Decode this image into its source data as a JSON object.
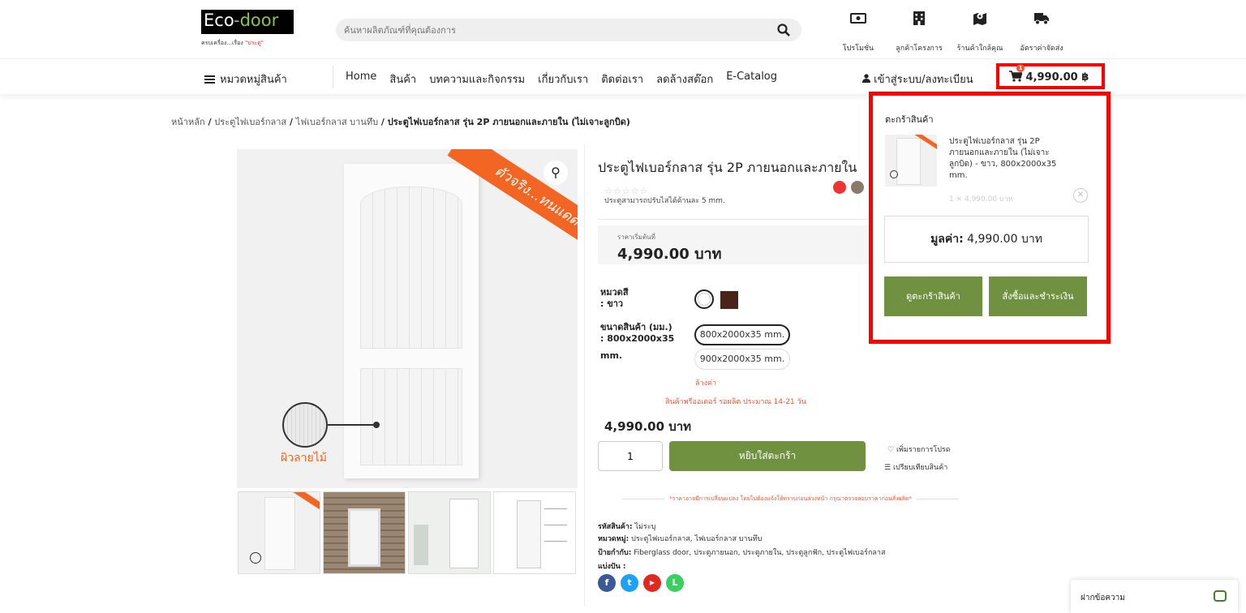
{
  "header": {
    "logo_eco": "Eco",
    "logo_door": "-door",
    "logo_tagline": "ครบเครื่อง...เรื่อง",
    "logo_tagline_accent": "\"ประตู\"",
    "search_placeholder": "ค้นหาผลิตภัณฑ์ที่คุณต้องการ",
    "quick_links": [
      {
        "label": "โปรโมชั่น",
        "icon": "money-icon"
      },
      {
        "label": "ลูกค้าโครงการ",
        "icon": "building-icon"
      },
      {
        "label": "ร้านค้าใกล้คุณ",
        "icon": "map-icon"
      },
      {
        "label": "อัตราค่าจัดส่ง",
        "icon": "truck-icon"
      }
    ]
  },
  "nav": {
    "category_label": "หมวดหมู่สินค้า",
    "items": [
      "Home",
      "สินค้า",
      "บทความและกิจกรรม",
      "เกี่ยวกับเรา",
      "ติดต่อเรา",
      "ลดล้างสต๊อก",
      "E-Catalog"
    ],
    "login_label": "เข้าสู่ระบบ/ลงทะเบียน",
    "cart_total": "4,990.00 ฿",
    "cart_count": "1"
  },
  "breadcrumb": {
    "items": [
      "หน้าหลัก",
      "ประตูไฟเบอร์กลาส",
      "ไฟเบอร์กลาส บานทึบ"
    ],
    "current": "ประตูไฟเบอร์กลาส รุ่น 2P ภายนอกและภายใน (ไม่เจาะลูกบิด)",
    "separator": " / "
  },
  "gallery": {
    "ribbon_text": "ตัวจริง...ทนแดด",
    "wood_label": "ผิวลายไม้"
  },
  "product": {
    "title": "ประตูไฟเบอร์กลาส รุ่น 2P ภายนอกและภายใน",
    "stars": "☆☆☆☆☆",
    "rating": 0,
    "tagline": "ประตูสามารถปรับไสได้ด้านละ 5 mm.",
    "price_label": "ราคาเริ่มต้นที่",
    "price": "4,990.00 บาท",
    "color_label": "หมวดสี",
    "color_value": ": ขาว",
    "swatches": [
      "#ffffff",
      "#4a2418"
    ],
    "size_label": "ขนาดสินค้า (มม.)",
    "size_value": ": 800x2000x35",
    "size_unit": "mm.",
    "size_options": [
      "800x2000x35 mm.",
      "900x2000x35 mm."
    ],
    "clear_label": "ล้างค่า",
    "lead_time": "สินค้าพรีออเดอร์ รอผลิต ประมาณ 14-21 วัน",
    "variant_price": "4,990.00 บาท",
    "quantity": "1",
    "add_to_cart": "หยิบใส่ตะกร้า",
    "wishlist": "เพิ่มรายการโปรด",
    "compare": "เปรียบเทียบสินค้า",
    "disclaimer": "*ราคาอาจมีการเปลี่ยนแปลง โดยไม่ต้องแจ้งให้ทราบก่อนล่วงหน้า กรุณาตรวจสอบราคาก่อนสั่งผลิต*",
    "sku_label": "รหัสสินค้า:",
    "sku_value": "ไม่ระบุ",
    "category_label": "หมวดหมู่:",
    "category_value": "ประตูไฟเบอร์กลาส, ไฟเบอร์กลาส บานทึบ",
    "tags_label": "ป้ายกำกับ:",
    "tags_value": "Fiberglass door, ประตูภายนอก, ประตูภายใน, ประตูลูกฟัก, ประตูไฟเบอร์กลาส",
    "share_label": "แบ่งปัน :",
    "social": [
      {
        "name": "facebook-icon",
        "glyph": "f",
        "color": "#3b5998"
      },
      {
        "name": "twitter-icon",
        "glyph": "t",
        "color": "#1da1f2"
      },
      {
        "name": "youtube-icon",
        "glyph": "▶",
        "color": "#e02a20"
      },
      {
        "name": "line-icon",
        "glyph": "L",
        "color": "#3acf5f"
      }
    ]
  },
  "minicart": {
    "title": "ตะกร้าสินค้า",
    "item_name": "ประตูไฟเบอร์กลาส รุ่น 2P ภายนอกและภายใน (ไม่เจาะลูกบิด) - ขาว, 800x2000x35 mm.",
    "item_qty": "1 × 4,990.00 บาท",
    "subtotal_label": "มูลค่า:",
    "subtotal_value": "4,990.00 บาท",
    "view_cart": "ดูตะกร้าสินค้า",
    "checkout": "สั่งซื้อและชำระเงิน"
  },
  "chat": {
    "label": "ฝากข้อความ"
  },
  "colors": {
    "accent": "#6f9140",
    "orange": "#f26522",
    "highlight": "#ff0000"
  }
}
